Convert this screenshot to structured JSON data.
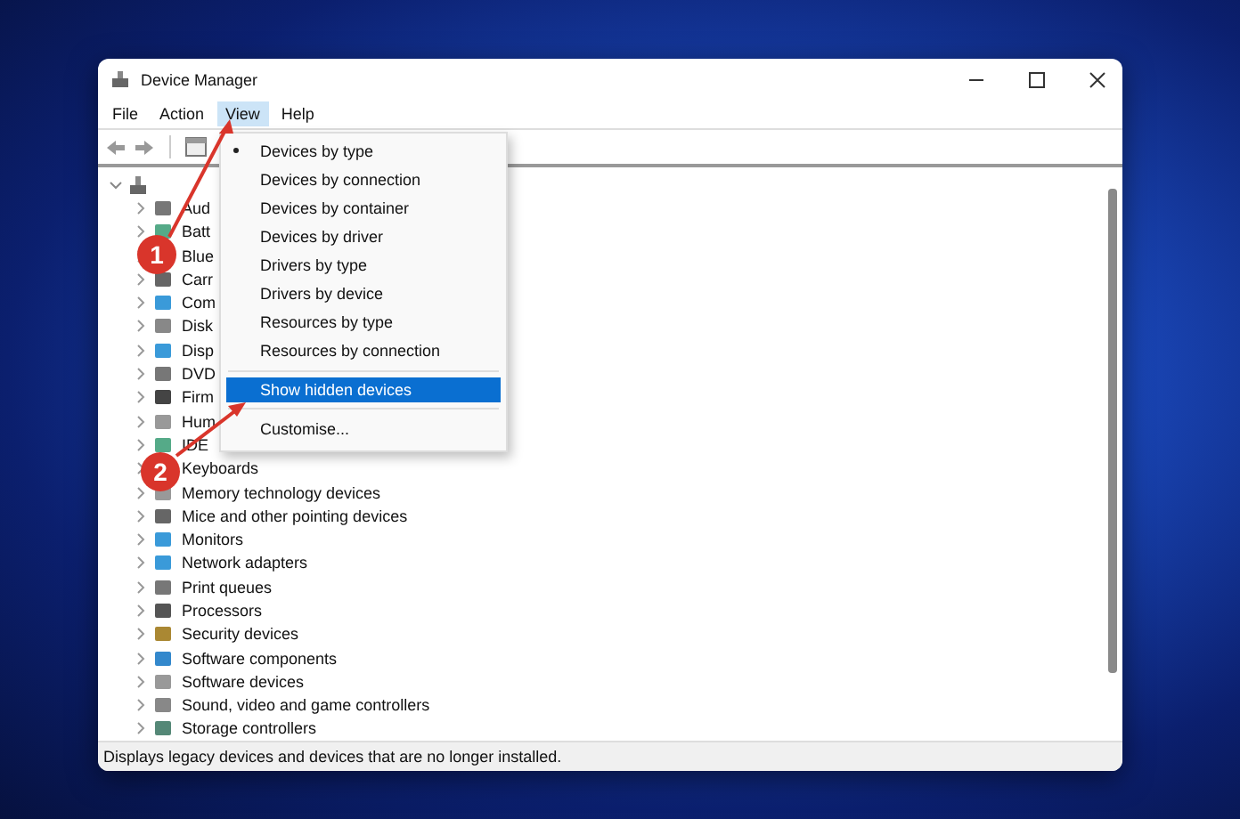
{
  "window": {
    "title": "Device Manager"
  },
  "menu_bar": [
    {
      "label": "File",
      "selected": false
    },
    {
      "label": "Action",
      "selected": false
    },
    {
      "label": "View",
      "selected": true
    },
    {
      "label": "Help",
      "selected": false
    }
  ],
  "view_menu": [
    {
      "label": "Devices by type",
      "selected": true,
      "highlighted": false,
      "separator_before": false
    },
    {
      "label": "Devices by connection",
      "selected": false,
      "highlighted": false,
      "separator_before": false
    },
    {
      "label": "Devices by container",
      "selected": false,
      "highlighted": false,
      "separator_before": false
    },
    {
      "label": "Devices by driver",
      "selected": false,
      "highlighted": false,
      "separator_before": false
    },
    {
      "label": "Drivers by type",
      "selected": false,
      "highlighted": false,
      "separator_before": false
    },
    {
      "label": "Drivers by device",
      "selected": false,
      "highlighted": false,
      "separator_before": false
    },
    {
      "label": "Resources by type",
      "selected": false,
      "highlighted": false,
      "separator_before": false
    },
    {
      "label": "Resources by connection",
      "selected": false,
      "highlighted": false,
      "separator_before": false
    },
    {
      "label": "Show hidden devices",
      "selected": false,
      "highlighted": true,
      "separator_before": true
    },
    {
      "label": "Customise...",
      "selected": false,
      "highlighted": false,
      "separator_before": true
    }
  ],
  "tree": {
    "expanded": true,
    "children": [
      {
        "label": "Aud",
        "expanded": false
      },
      {
        "label": "Batt",
        "expanded": false
      },
      {
        "label": "Blue",
        "expanded": false
      },
      {
        "label": "Carr",
        "expanded": false
      },
      {
        "label": "Com",
        "expanded": false
      },
      {
        "label": "Disk",
        "expanded": false
      },
      {
        "label": "Disp",
        "expanded": false
      },
      {
        "label": "DVD",
        "expanded": false
      },
      {
        "label": "Firm",
        "expanded": false
      },
      {
        "label": "Hum",
        "expanded": false
      },
      {
        "label": "IDE",
        "expanded": false
      },
      {
        "label": "Keyboards",
        "expanded": false
      },
      {
        "label": "Memory technology devices",
        "expanded": false
      },
      {
        "label": "Mice and other pointing devices",
        "expanded": false
      },
      {
        "label": "Monitors",
        "expanded": false
      },
      {
        "label": "Network adapters",
        "expanded": false
      },
      {
        "label": "Print queues",
        "expanded": false
      },
      {
        "label": "Processors",
        "expanded": false
      },
      {
        "label": "Security devices",
        "expanded": false
      },
      {
        "label": "Software components",
        "expanded": false
      },
      {
        "label": "Software devices",
        "expanded": false
      },
      {
        "label": "Sound, video and game controllers",
        "expanded": false
      },
      {
        "label": "Storage controllers",
        "expanded": false
      }
    ]
  },
  "status_bar": "Displays legacy devices and devices that are no longer installed.",
  "callouts": [
    {
      "number": "1"
    },
    {
      "number": "2"
    }
  ]
}
